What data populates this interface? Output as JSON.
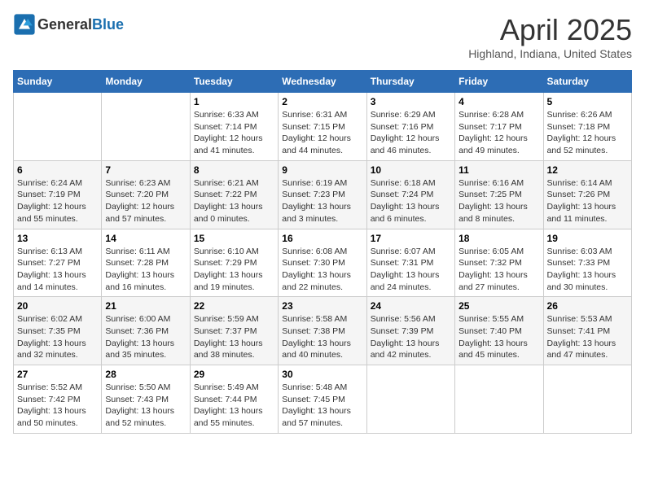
{
  "header": {
    "logo_general": "General",
    "logo_blue": "Blue",
    "month": "April 2025",
    "location": "Highland, Indiana, United States"
  },
  "days_of_week": [
    "Sunday",
    "Monday",
    "Tuesday",
    "Wednesday",
    "Thursday",
    "Friday",
    "Saturday"
  ],
  "weeks": [
    [
      {
        "day": "",
        "info": ""
      },
      {
        "day": "",
        "info": ""
      },
      {
        "day": "1",
        "info": "Sunrise: 6:33 AM\nSunset: 7:14 PM\nDaylight: 12 hours and 41 minutes."
      },
      {
        "day": "2",
        "info": "Sunrise: 6:31 AM\nSunset: 7:15 PM\nDaylight: 12 hours and 44 minutes."
      },
      {
        "day": "3",
        "info": "Sunrise: 6:29 AM\nSunset: 7:16 PM\nDaylight: 12 hours and 46 minutes."
      },
      {
        "day": "4",
        "info": "Sunrise: 6:28 AM\nSunset: 7:17 PM\nDaylight: 12 hours and 49 minutes."
      },
      {
        "day": "5",
        "info": "Sunrise: 6:26 AM\nSunset: 7:18 PM\nDaylight: 12 hours and 52 minutes."
      }
    ],
    [
      {
        "day": "6",
        "info": "Sunrise: 6:24 AM\nSunset: 7:19 PM\nDaylight: 12 hours and 55 minutes."
      },
      {
        "day": "7",
        "info": "Sunrise: 6:23 AM\nSunset: 7:20 PM\nDaylight: 12 hours and 57 minutes."
      },
      {
        "day": "8",
        "info": "Sunrise: 6:21 AM\nSunset: 7:22 PM\nDaylight: 13 hours and 0 minutes."
      },
      {
        "day": "9",
        "info": "Sunrise: 6:19 AM\nSunset: 7:23 PM\nDaylight: 13 hours and 3 minutes."
      },
      {
        "day": "10",
        "info": "Sunrise: 6:18 AM\nSunset: 7:24 PM\nDaylight: 13 hours and 6 minutes."
      },
      {
        "day": "11",
        "info": "Sunrise: 6:16 AM\nSunset: 7:25 PM\nDaylight: 13 hours and 8 minutes."
      },
      {
        "day": "12",
        "info": "Sunrise: 6:14 AM\nSunset: 7:26 PM\nDaylight: 13 hours and 11 minutes."
      }
    ],
    [
      {
        "day": "13",
        "info": "Sunrise: 6:13 AM\nSunset: 7:27 PM\nDaylight: 13 hours and 14 minutes."
      },
      {
        "day": "14",
        "info": "Sunrise: 6:11 AM\nSunset: 7:28 PM\nDaylight: 13 hours and 16 minutes."
      },
      {
        "day": "15",
        "info": "Sunrise: 6:10 AM\nSunset: 7:29 PM\nDaylight: 13 hours and 19 minutes."
      },
      {
        "day": "16",
        "info": "Sunrise: 6:08 AM\nSunset: 7:30 PM\nDaylight: 13 hours and 22 minutes."
      },
      {
        "day": "17",
        "info": "Sunrise: 6:07 AM\nSunset: 7:31 PM\nDaylight: 13 hours and 24 minutes."
      },
      {
        "day": "18",
        "info": "Sunrise: 6:05 AM\nSunset: 7:32 PM\nDaylight: 13 hours and 27 minutes."
      },
      {
        "day": "19",
        "info": "Sunrise: 6:03 AM\nSunset: 7:33 PM\nDaylight: 13 hours and 30 minutes."
      }
    ],
    [
      {
        "day": "20",
        "info": "Sunrise: 6:02 AM\nSunset: 7:35 PM\nDaylight: 13 hours and 32 minutes."
      },
      {
        "day": "21",
        "info": "Sunrise: 6:00 AM\nSunset: 7:36 PM\nDaylight: 13 hours and 35 minutes."
      },
      {
        "day": "22",
        "info": "Sunrise: 5:59 AM\nSunset: 7:37 PM\nDaylight: 13 hours and 38 minutes."
      },
      {
        "day": "23",
        "info": "Sunrise: 5:58 AM\nSunset: 7:38 PM\nDaylight: 13 hours and 40 minutes."
      },
      {
        "day": "24",
        "info": "Sunrise: 5:56 AM\nSunset: 7:39 PM\nDaylight: 13 hours and 42 minutes."
      },
      {
        "day": "25",
        "info": "Sunrise: 5:55 AM\nSunset: 7:40 PM\nDaylight: 13 hours and 45 minutes."
      },
      {
        "day": "26",
        "info": "Sunrise: 5:53 AM\nSunset: 7:41 PM\nDaylight: 13 hours and 47 minutes."
      }
    ],
    [
      {
        "day": "27",
        "info": "Sunrise: 5:52 AM\nSunset: 7:42 PM\nDaylight: 13 hours and 50 minutes."
      },
      {
        "day": "28",
        "info": "Sunrise: 5:50 AM\nSunset: 7:43 PM\nDaylight: 13 hours and 52 minutes."
      },
      {
        "day": "29",
        "info": "Sunrise: 5:49 AM\nSunset: 7:44 PM\nDaylight: 13 hours and 55 minutes."
      },
      {
        "day": "30",
        "info": "Sunrise: 5:48 AM\nSunset: 7:45 PM\nDaylight: 13 hours and 57 minutes."
      },
      {
        "day": "",
        "info": ""
      },
      {
        "day": "",
        "info": ""
      },
      {
        "day": "",
        "info": ""
      }
    ]
  ]
}
